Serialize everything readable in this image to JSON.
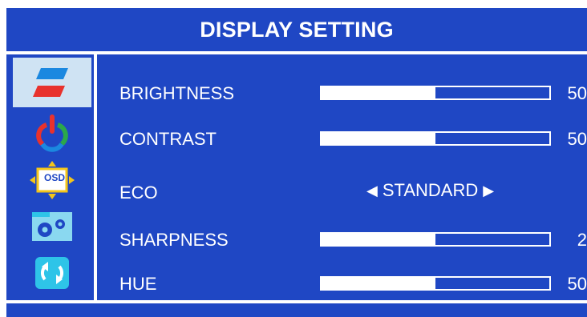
{
  "title": "DISPLAY SETTING",
  "sidebar": {
    "items": [
      {
        "icon": "display-icon",
        "selected": true
      },
      {
        "icon": "color-icon",
        "selected": false
      },
      {
        "icon": "osd-icon",
        "label": "OSD",
        "selected": false
      },
      {
        "icon": "settings-icon",
        "selected": false
      },
      {
        "icon": "reset-icon",
        "selected": false
      }
    ]
  },
  "settings": {
    "brightness": {
      "label": "BRIGHTNESS",
      "value": "50",
      "fill": 0.5
    },
    "contrast": {
      "label": "CONTRAST",
      "value": "50",
      "fill": 0.5
    },
    "eco": {
      "label": "ECO",
      "value": "STANDARD"
    },
    "sharpness": {
      "label": "SHARPNESS",
      "value": "2",
      "fill": 0.5
    },
    "hue": {
      "label": "HUE",
      "value": "50",
      "fill": 0.5
    }
  },
  "colors": {
    "background": "#1f47c4",
    "selected": "#cfe3f3",
    "text": "#ffffff"
  }
}
